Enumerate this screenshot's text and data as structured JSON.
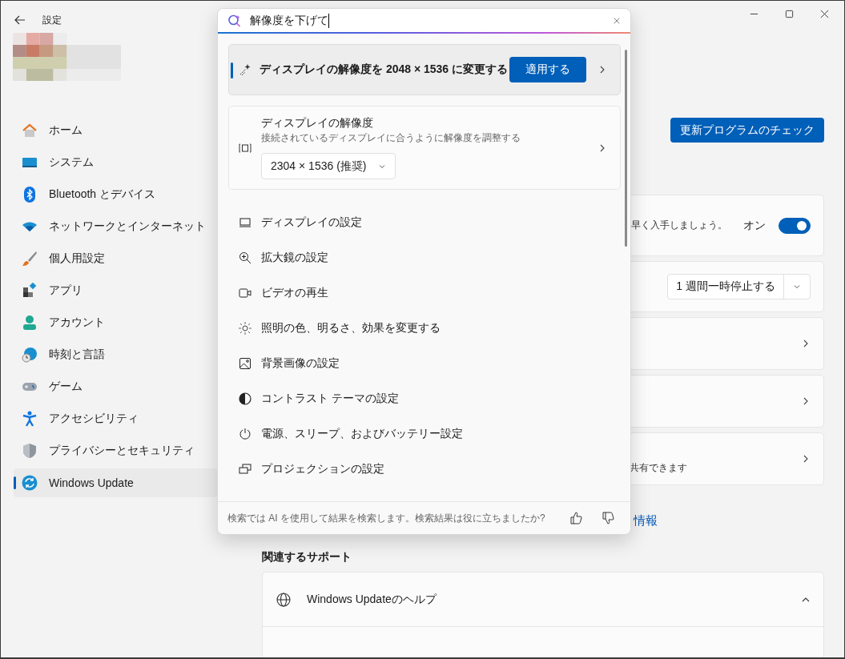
{
  "window": {
    "title": "設定"
  },
  "sidebar": {
    "items": [
      {
        "label": "ホーム",
        "selected": false
      },
      {
        "label": "システム",
        "selected": false
      },
      {
        "label": "Bluetooth とデバイス",
        "selected": false
      },
      {
        "label": "ネットワークとインターネット",
        "selected": false
      },
      {
        "label": "個人用設定",
        "selected": false
      },
      {
        "label": "アプリ",
        "selected": false
      },
      {
        "label": "アカウント",
        "selected": false
      },
      {
        "label": "時刻と言語",
        "selected": false
      },
      {
        "label": "ゲーム",
        "selected": false
      },
      {
        "label": "アクセシビリティ",
        "selected": false
      },
      {
        "label": "プライバシーとセキュリティ",
        "selected": false
      },
      {
        "label": "Windows Update",
        "selected": true
      }
    ]
  },
  "content": {
    "check_button": "更新プログラムのチェック",
    "cards": [
      {
        "kind": "toggle",
        "description": "早く入手しましょう。",
        "state_label": "オン",
        "on": true
      },
      {
        "kind": "dropdown",
        "value": "1 週間一時停止する"
      },
      {
        "kind": "link"
      },
      {
        "kind": "link"
      },
      {
        "kind": "link",
        "description": "共有できます"
      }
    ],
    "link": "情報",
    "related_support": {
      "heading": "関連するサポート",
      "items": [
        {
          "label": "Windows Updateのヘルプ",
          "expanded": true
        }
      ]
    }
  },
  "search_popup": {
    "query": "解像度を下げて",
    "suggestion": {
      "text": "ディスプレイの解像度を 2048 × 1536 に変更する",
      "button": "適用する"
    },
    "setting_card": {
      "title": "ディスプレイの解像度",
      "subtitle": "接続されているディスプレイに合うように解像度を調整する",
      "dropdown": "2304 × 1536 (推奨)"
    },
    "results": [
      "ディスプレイの設定",
      "拡大鏡の設定",
      "ビデオの再生",
      "照明の色、明るさ、効果を変更する",
      "背景画像の設定",
      "コントラスト テーマの設定",
      "電源、スリープ、およびバッテリー設定",
      "プロジェクションの設定"
    ],
    "footer": "検索では AI を使用して結果を検索します。検索結果は役に立ちましたか?"
  }
}
